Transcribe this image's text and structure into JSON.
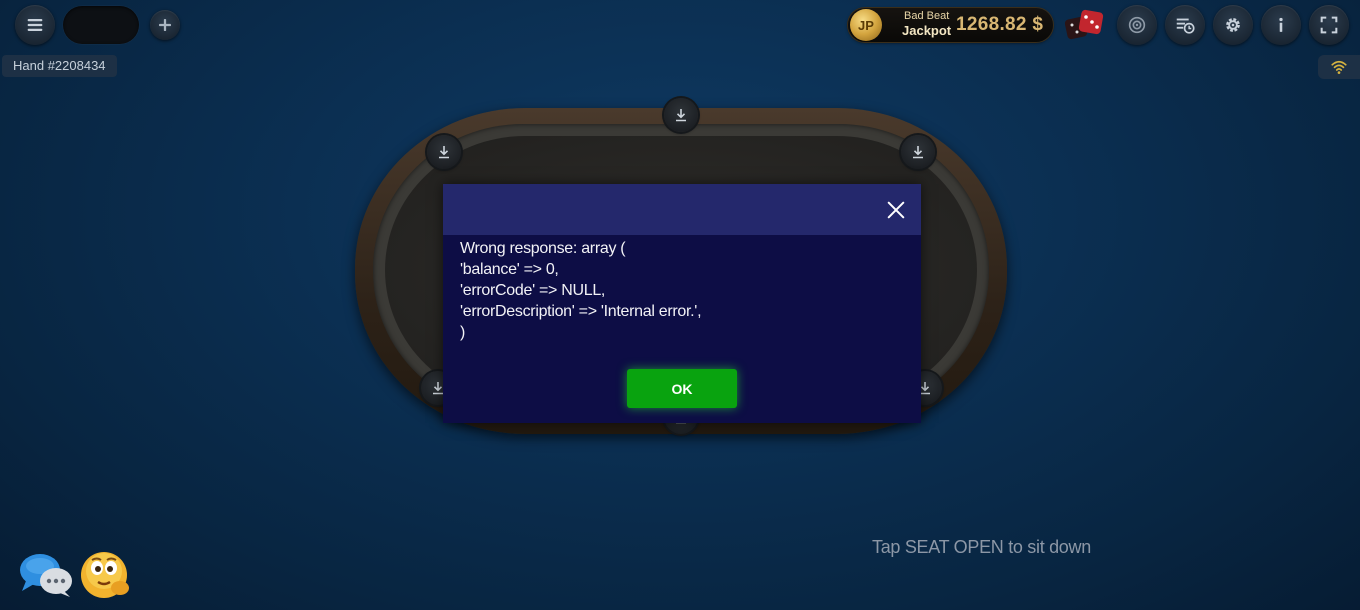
{
  "hand": {
    "label": "Hand #2208434"
  },
  "jackpot": {
    "badge": "JP",
    "line1": "Bad Beat",
    "line2": "Jackpot",
    "amount": "1268.82 $",
    "colors": {
      "amount": "#d9b773",
      "coin": "#d3a43e"
    }
  },
  "toolbar": {
    "icons": [
      "menu-icon",
      "add-icon",
      "dice-icon",
      "target-icon",
      "hand-history-icon",
      "gear-icon",
      "info-icon",
      "fullscreen-icon"
    ]
  },
  "table": {
    "seats": [
      "seat-top",
      "seat-top-left",
      "seat-top-right",
      "seat-bottom-left",
      "seat-bottom-right",
      "seat-bottom"
    ]
  },
  "dialog": {
    "lines": [
      "Wrong response: array (",
      "'balance' => 0,",
      "'errorCode' => NULL,",
      "'errorDescription' => 'Internal error.',",
      ")"
    ],
    "ok_label": "OK",
    "colors": {
      "header": "#24286c",
      "body": "#0d0d45",
      "ok": "#09a30f"
    }
  },
  "hint": {
    "text": "Tap SEAT OPEN to sit down"
  }
}
